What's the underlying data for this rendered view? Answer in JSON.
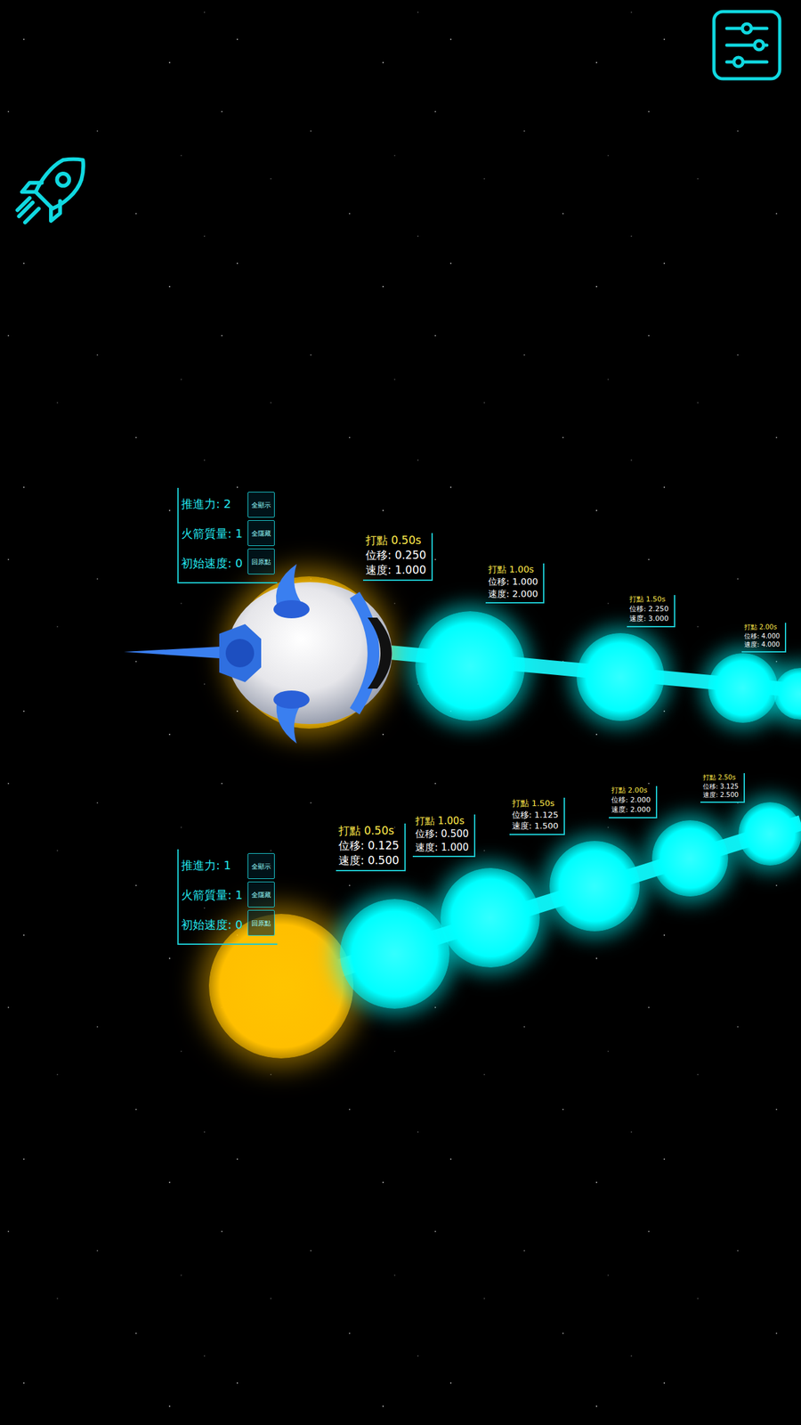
{
  "tracks": [
    {
      "kind": "rocket",
      "params": [
        "推進力: 2",
        "火箭質量: 1",
        "初始速度: 0"
      ],
      "buttons": [
        "全顯示",
        "全隱藏",
        "回原點"
      ],
      "markers": [
        {
          "time": "打點 0.50s",
          "displacement": "位移: 0.250",
          "velocity": "速度: 1.000"
        },
        {
          "time": "打點 1.00s",
          "displacement": "位移: 1.000",
          "velocity": "速度: 2.000"
        },
        {
          "time": "打點 1.50s",
          "displacement": "位移: 2.250",
          "velocity": "速度: 3.000"
        },
        {
          "time": "打點 2.00s",
          "displacement": "位移: 4.000",
          "velocity": "速度: 4.000"
        }
      ]
    },
    {
      "kind": "dot",
      "params": [
        "推進力: 1",
        "火箭質量: 1",
        "初始速度: 0"
      ],
      "buttons": [
        "全顯示",
        "全隱藏",
        "回原點"
      ],
      "markers": [
        {
          "time": "打點 0.50s",
          "displacement": "位移: 0.125",
          "velocity": "速度: 0.500"
        },
        {
          "time": "打點 1.00s",
          "displacement": "位移: 0.500",
          "velocity": "速度: 1.000"
        },
        {
          "time": "打點 1.50s",
          "displacement": "位移: 1.125",
          "velocity": "速度: 1.500"
        },
        {
          "time": "打點 2.00s",
          "displacement": "位移: 2.000",
          "velocity": "速度: 2.000"
        },
        {
          "time": "打點 2.50s",
          "displacement": "位移: 3.125",
          "velocity": "速度: 2.500"
        }
      ]
    }
  ]
}
